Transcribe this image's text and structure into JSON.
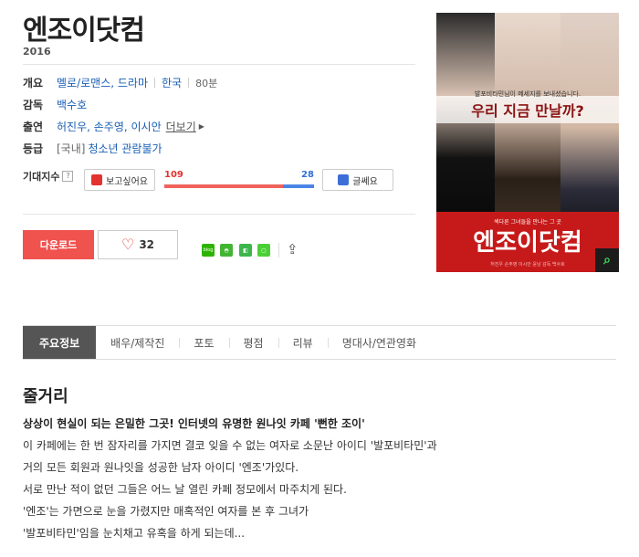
{
  "movie": {
    "title": "엔조이닷컴",
    "year": "2016"
  },
  "info": {
    "overview_key": "개요",
    "genre": "멜로/로맨스, 드라마",
    "country": "한국",
    "runtime": "80분",
    "director_key": "감독",
    "director": "백수호",
    "cast_key": "출연",
    "cast": "허진우, 손주영, 이시안",
    "more_label": "더보기",
    "rating_key": "등급",
    "rating_prefix": "[국내]",
    "rating": "청소년 관람불가"
  },
  "expect": {
    "label": "기대지수",
    "want_label": "보고싶어요",
    "dislike_label": "글쎄요",
    "want_count": "109",
    "dislike_count": "28",
    "want_share": 0.7957
  },
  "actions": {
    "download_label": "다운로드",
    "like_count": "32"
  },
  "share_icons": [
    "blog-icon",
    "kakaostory-icon",
    "band-icon",
    "line-icon",
    "share-out-icon"
  ],
  "share_labels": {
    "blog": "blog"
  },
  "poster": {
    "top_text": "발포비타민님이 메세지를 보내셨습니다.",
    "headline": "우리 지금 만날까?",
    "subtitle": "섹다른 그녀들을 만나는 그 곳",
    "title": "엔조이닷컴",
    "credits": "허진우  손주영  이시안  윤남  감독 백수호"
  },
  "tabs": [
    "주요정보",
    "배우/제작진",
    "포토",
    "평점",
    "리뷰",
    "명대사/연관영화"
  ],
  "synopsis": {
    "heading": "줄거리",
    "lead": "상상이 현실이 되는 은밀한 그곳! 인터넷의 유명한 원나잇 카페 '뻔한 조이'",
    "lines": [
      "이 카페에는 한 번 잠자리를 가지면 결코 잊을 수 없는 여자로 소문난 아이디 '발포비타민'과",
      " 거의 모든 회원과 원나잇을 성공한 남자 아이디 '엔조'가있다.",
      " 서로 만난 적이 없던 그들은 어느 날 열린 카페 정모에서 마주치게 된다.",
      " '엔조'는 가면으로 눈을 가렸지만 매혹적인 여자를 본 후 그녀가",
      " '발포비타민'임을 눈치채고 유혹을 하게 되는데..."
    ]
  },
  "colors": {
    "accent_red": "#f0524e",
    "link_blue": "#1a5fb4",
    "dislike_blue": "#4a84e6",
    "tab_active": "#555555"
  }
}
